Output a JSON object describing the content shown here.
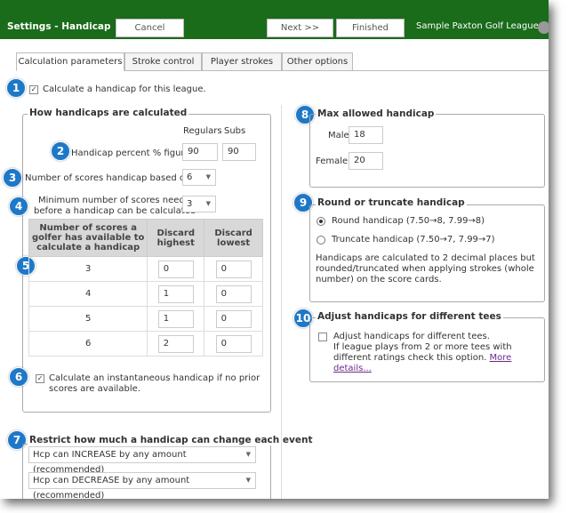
{
  "header": {
    "title": "Settings - Handicap",
    "cancel": "Cancel",
    "next": "Next >>",
    "finished": "Finished",
    "league": "Sample Paxton Golf League"
  },
  "tabs": [
    "Calculation parameters",
    "Stroke control",
    "Player strokes",
    "Other options"
  ],
  "markers": [
    "1",
    "2",
    "3",
    "4",
    "5",
    "6",
    "7",
    "8",
    "9",
    "10"
  ],
  "calc_league": {
    "checked": true,
    "label": "Calculate a handicap for this league."
  },
  "how": {
    "legend": "How handicaps are calculated",
    "col_regulars": "Regulars",
    "col_subs": "Subs",
    "percent_label": "Handicap percent % figure",
    "percent_regulars": "90",
    "percent_subs": "90",
    "scores_label": "Number of scores handicap based on",
    "scores_value": "6",
    "min_label_1": "Minimum number of scores needed",
    "min_label_2": "before a handicap can be calculated",
    "min_value": "3",
    "table": {
      "headers": [
        "Number of scores a golfer has available to calculate a handicap",
        "Discard highest",
        "Discard lowest"
      ],
      "rows": [
        [
          "3",
          "0",
          "0"
        ],
        [
          "4",
          "1",
          "0"
        ],
        [
          "5",
          "1",
          "0"
        ],
        [
          "6",
          "2",
          "0"
        ]
      ]
    },
    "instant_checked": true,
    "instant_1": "Calculate an instantaneous handicap if no prior",
    "instant_2": "scores are available."
  },
  "restrict": {
    "legend": "Restrict how much a handicap can change each event",
    "increase": "Hcp can INCREASE by any amount (recommended)",
    "decrease": "Hcp can DECREASE by any amount (recommended)"
  },
  "max": {
    "legend": "Max allowed handicap",
    "male_label": "Male",
    "male_value": "18",
    "female_label": "Female",
    "female_value": "20"
  },
  "round": {
    "legend": "Round or truncate handicap",
    "round_label": "Round handicap (7.50→8, 7.99→8)",
    "truncate_label": "Truncate handicap (7.50→7, 7.99→7)",
    "selected": "round",
    "note_1": "Handicaps are calculated to 2 decimal places but",
    "note_2": "rounded/truncated when applying strokes (whole",
    "note_3": "number) on the score cards."
  },
  "tees": {
    "legend": "Adjust handicaps for different tees",
    "checked": false,
    "label": "Adjust handicaps for different tees.",
    "desc_1": "If league plays from 2 or more tees with",
    "desc_2": "different ratings check this option.",
    "more": "More",
    "details": "details..."
  }
}
